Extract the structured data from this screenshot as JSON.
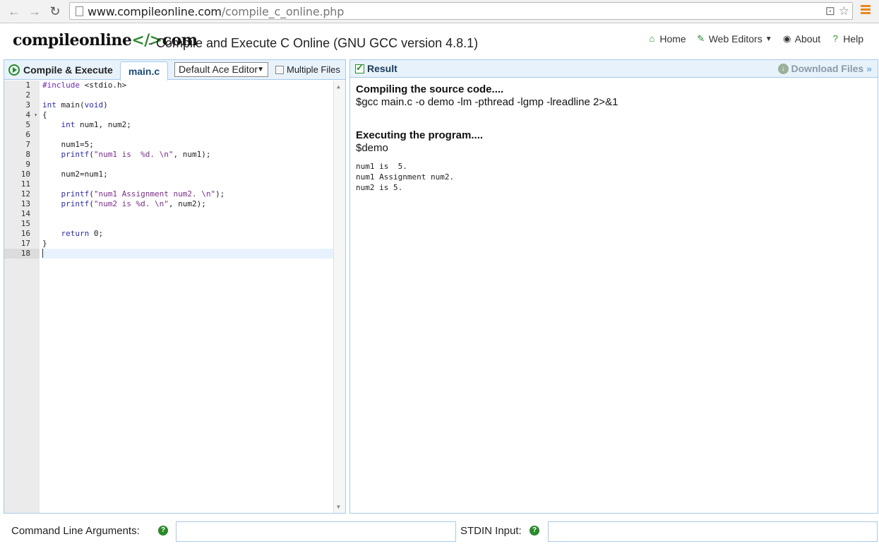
{
  "browser": {
    "url_domain": "www.compileonline.com",
    "url_path": "/compile_c_online.php",
    "back_icon": "arrow-left-icon",
    "forward_icon": "arrow-right-icon",
    "reload_icon": "reload-icon"
  },
  "header": {
    "logo_left": "compileonline",
    "logo_bracket": "</>",
    "logo_right": "com",
    "title": "- Compile and Execute C Online (GNU GCC version 4.8.1)",
    "nav": [
      {
        "label": "Home",
        "icon": "home-icon"
      },
      {
        "label": "Web Editors",
        "icon": "pencil-icon"
      },
      {
        "label": "About",
        "icon": "user-icon"
      },
      {
        "label": "Help",
        "icon": "question-icon"
      }
    ]
  },
  "left_panel": {
    "compile_label": "Compile & Execute",
    "tab_label": "main.c",
    "editor_select": "Default Ace Editor",
    "multiple_files_label": "Multiple Files",
    "line_numbers": [
      "1",
      "2",
      "3",
      "4",
      "5",
      "6",
      "7",
      "8",
      "9",
      "10",
      "11",
      "12",
      "13",
      "14",
      "15",
      "16",
      "17",
      "18"
    ]
  },
  "right_panel": {
    "result_label": "Result",
    "download_label": "Download Files",
    "compile_heading": "Compiling the source code....",
    "compile_cmd": "$gcc main.c -o demo -lm -pthread -lgmp -lreadline 2>&1",
    "exec_heading": "Executing the program....",
    "exec_cmd": "$demo",
    "output": [
      "num1 is  5.",
      "num1 Assignment num2.",
      "num2 is 5."
    ]
  },
  "footer": {
    "args_label": "Command Line Arguments:",
    "stdin_label": "STDIN Input:"
  },
  "colors": {
    "accent_green": "#2a8a2a",
    "panel_border": "#a9c9e8",
    "panel_header_bg": "#e8f2fb",
    "menu_orange": "#e8891d"
  }
}
